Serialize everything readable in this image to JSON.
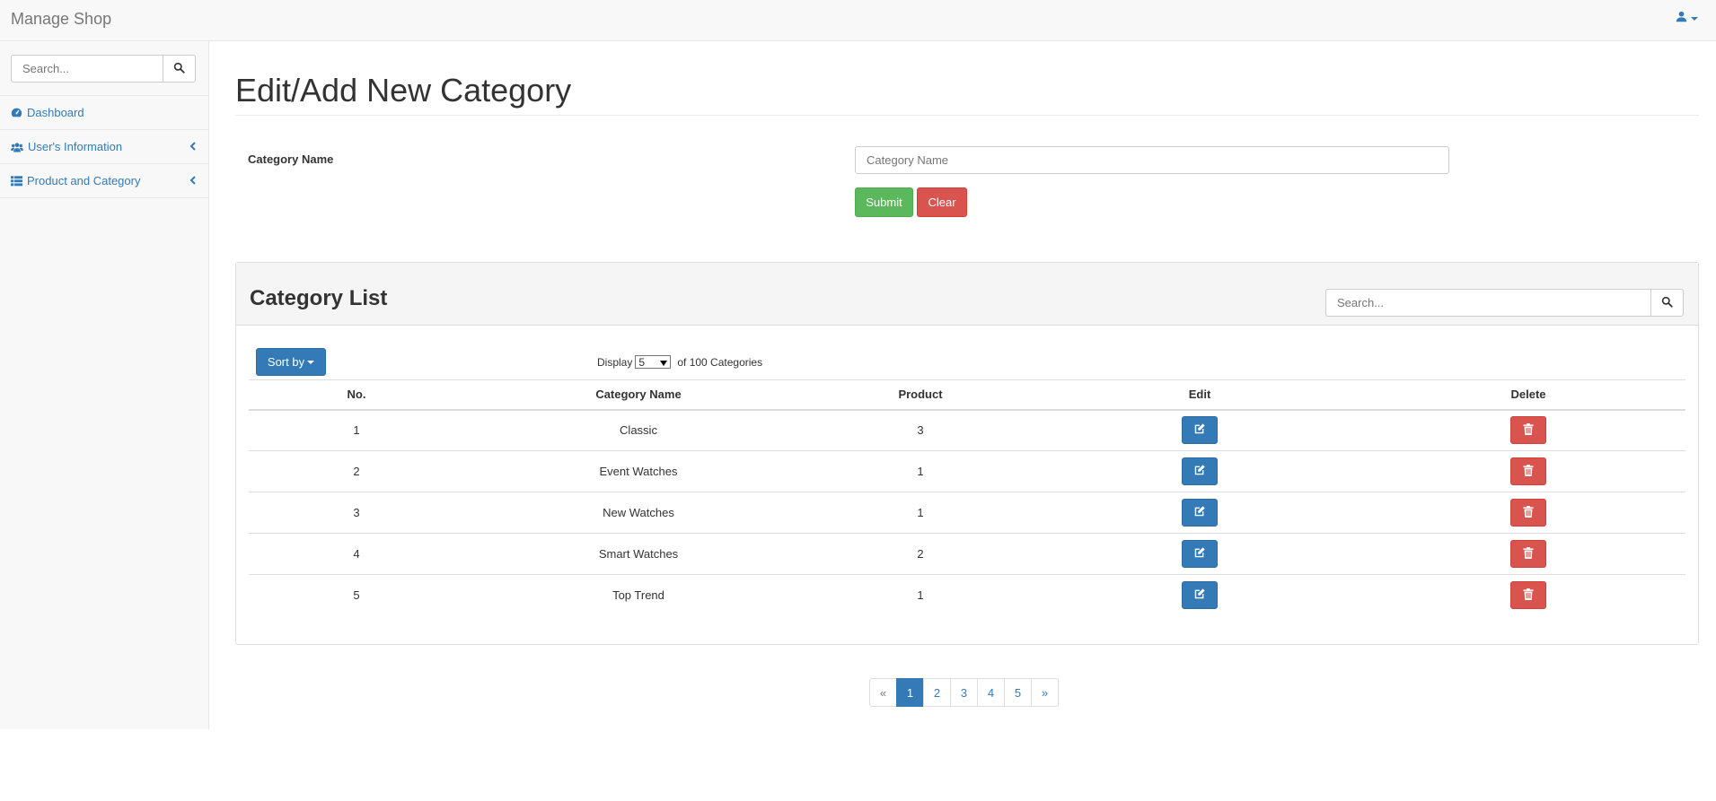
{
  "navbar": {
    "brand": "Manage Shop",
    "user_icon": "user-icon"
  },
  "sidebar": {
    "search_placeholder": "Search...",
    "items": [
      {
        "label": "Dashboard",
        "icon": "dashboard-icon",
        "has_submenu": false
      },
      {
        "label": "User's Information",
        "icon": "users-icon",
        "has_submenu": true
      },
      {
        "label": "Product and Category",
        "icon": "table-icon",
        "has_submenu": true
      }
    ]
  },
  "page": {
    "title": "Edit/Add New Category"
  },
  "form": {
    "label": "Category Name",
    "placeholder": "Category Name",
    "submit_label": "Submit",
    "clear_label": "Clear"
  },
  "list": {
    "title": "Category List",
    "search_placeholder": "Search...",
    "sort_label": "Sort by",
    "display_prefix": "Display",
    "display_value": "5",
    "display_suffix": "of 100 Categories",
    "columns": [
      "No.",
      "Category Name",
      "Product",
      "Edit",
      "Delete"
    ],
    "rows": [
      {
        "no": "1",
        "name": "Classic",
        "product": "3"
      },
      {
        "no": "2",
        "name": "Event Watches",
        "product": "1"
      },
      {
        "no": "3",
        "name": "New Watches",
        "product": "1"
      },
      {
        "no": "4",
        "name": "Smart Watches",
        "product": "2"
      },
      {
        "no": "5",
        "name": "Top Trend",
        "product": "1"
      }
    ]
  },
  "pagination": {
    "prev": "«",
    "pages": [
      "1",
      "2",
      "3",
      "4",
      "5"
    ],
    "active": "1",
    "next": "»"
  },
  "colors": {
    "primary": "#337ab7",
    "success": "#5cb85c",
    "danger": "#d9534f"
  }
}
